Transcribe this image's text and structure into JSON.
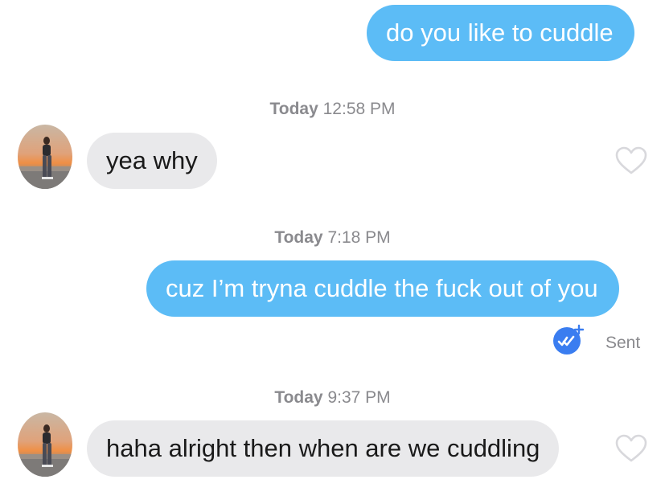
{
  "colors": {
    "sent_bubble": "#5cbcf6",
    "received_bubble": "#e9e9eb",
    "read_receipt": "#3a7df0"
  },
  "messages": [
    {
      "direction": "sent",
      "text": "do you like to cuddle"
    },
    {
      "timestamp_day": "Today",
      "timestamp_time": "12:58 PM"
    },
    {
      "direction": "received",
      "text": "yea why"
    },
    {
      "timestamp_day": "Today",
      "timestamp_time": "7:18 PM"
    },
    {
      "direction": "sent",
      "text": "cuz I’m tryna cuddle the fuck out of you"
    },
    {
      "timestamp_day": "Today",
      "timestamp_time": "9:37 PM"
    },
    {
      "direction": "received",
      "text": "haha alright then when are we cuddling"
    }
  ],
  "status": {
    "label": "Sent",
    "icon": "double-check-icon"
  },
  "icons": {
    "like": "heart-outline-icon",
    "avatar": "profile-photo"
  }
}
